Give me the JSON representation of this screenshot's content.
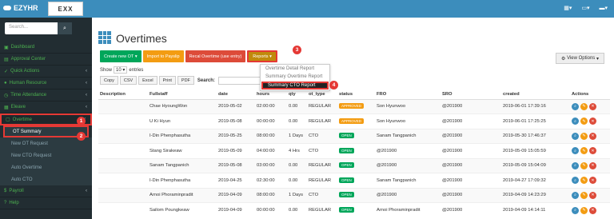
{
  "app": {
    "brand": "EZYHR",
    "logo_text": "EXX"
  },
  "sidebar": {
    "search_placeholder": "Search...",
    "items": [
      {
        "label": "Dashboard"
      },
      {
        "label": "Approval Center"
      },
      {
        "label": "Quick Actions"
      },
      {
        "label": "Human Resource"
      },
      {
        "label": "Time Attendance"
      },
      {
        "label": "Eleave"
      },
      {
        "label": "Overtime"
      }
    ],
    "subitems": [
      {
        "label": "OT Summary"
      },
      {
        "label": "New OT Request"
      },
      {
        "label": "New CTO Request"
      },
      {
        "label": "Auto Overtime"
      },
      {
        "label": "Auto CTO"
      }
    ],
    "bottom_items": [
      {
        "label": "Payroll"
      },
      {
        "label": "Help"
      }
    ]
  },
  "page": {
    "title": "Overtimes"
  },
  "toolbar": {
    "create_new": "Create new OT",
    "import": "Import to Payslip",
    "recal": "Recal Overtime (use entry)",
    "reports": "Reports",
    "view_options": "View Options"
  },
  "reports_menu": [
    "Overtime Detail Report",
    "Summary Overtime Report",
    "Summary CTO Report"
  ],
  "length": {
    "show": "Show",
    "value": "10",
    "entries": "entries"
  },
  "export": [
    "Copy",
    "CSV",
    "Excel",
    "Print",
    "PDF"
  ],
  "search_label": "Search:",
  "markers": [
    "1",
    "2",
    "3",
    "4"
  ],
  "table": {
    "headers": [
      "Description",
      "Fullstaff",
      "date",
      "hours",
      "qty",
      "ot_type",
      "status",
      "FRO",
      "SRO",
      "created",
      "Actions"
    ],
    "rows": [
      {
        "desc": "",
        "staff": "Chae HyoungWon",
        "date": "2019-05-02",
        "hours": "02:00:00",
        "qty": "0.00",
        "type": "REGULAR",
        "status": "APPROVED",
        "fro": "Son Hyunwoo",
        "sro": "@201900",
        "created": "2019-06-01 17:39:16"
      },
      {
        "desc": "",
        "staff": "U Ki Hyun",
        "date": "2019-05-08",
        "hours": "00:00:00",
        "qty": "0.00",
        "type": "REGULAR",
        "status": "APPROVED",
        "fro": "Son Hyunwoo",
        "sro": "@201900",
        "created": "2019-06-01 17:25:25"
      },
      {
        "desc": "",
        "staff": "I-Din Phenphasutha",
        "date": "2019-05-25",
        "hours": "08:00:00",
        "qty": "1 Days",
        "type": "CTO",
        "status": "OPEN",
        "fro": "Sanam Tangpanich",
        "sro": "@201900",
        "created": "2019-05-30 17:46:37"
      },
      {
        "desc": "",
        "staff": "Stang Sirakeaw",
        "date": "2019-05-09",
        "hours": "04:00:00",
        "qty": "4 Hrs",
        "type": "CTO",
        "status": "OPEN",
        "fro": "@201900",
        "sro": "@201900",
        "created": "2019-05-09 15:05:59"
      },
      {
        "desc": "",
        "staff": "Sanam Tangpanich",
        "date": "2019-05-08",
        "hours": "03:00:00",
        "qty": "0.00",
        "type": "REGULAR",
        "status": "OPEN",
        "fro": "@201900",
        "sro": "@201900",
        "created": "2019-05-09 15:04:09"
      },
      {
        "desc": "",
        "staff": "I-Din Phenphasutha",
        "date": "2019-04-25",
        "hours": "02:30:00",
        "qty": "0.00",
        "type": "REGULAR",
        "status": "OPEN",
        "fro": "Sanam Tangpanich",
        "sro": "@201900",
        "created": "2019-04-27 17:09:32"
      },
      {
        "desc": "",
        "staff": "Arnoi Phoraminpradit",
        "date": "2019-04-09",
        "hours": "08:00:00",
        "qty": "1 Days",
        "type": "CTO",
        "status": "OPEN",
        "fro": "@201900",
        "sro": "@201900",
        "created": "2019-04-09 14:23:29"
      },
      {
        "desc": "",
        "staff": "Sailom Poungkeaw",
        "date": "2019-04-09",
        "hours": "00:00:00",
        "qty": "0.00",
        "type": "REGULAR",
        "status": "OPEN",
        "fro": "Arnoi Phoraminpradit",
        "sro": "@201900",
        "created": "2019-04-09 14:14:11"
      }
    ]
  }
}
